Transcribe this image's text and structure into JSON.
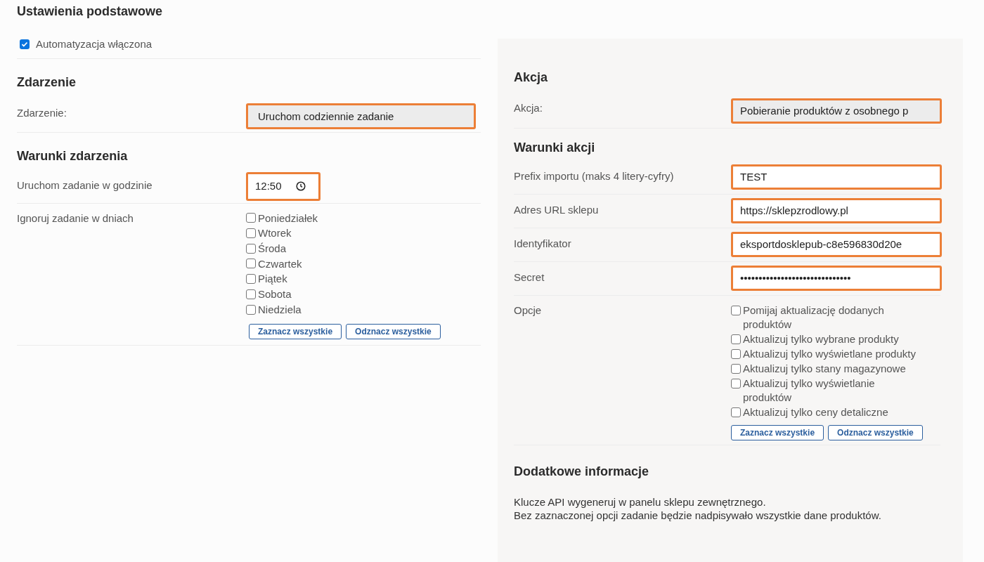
{
  "basic": {
    "title": "Ustawienia podstawowe",
    "automation": {
      "label": "Automatyzacja włączona",
      "checked": true
    }
  },
  "event": {
    "title": "Zdarzenie",
    "label": "Zdarzenie:",
    "value": "Uruchom codziennie zadanie"
  },
  "event_conditions": {
    "title": "Warunki zdarzenia",
    "time_label": "Uruchom zadanie w godzinie",
    "time_value": "12:50",
    "days_label": "Ignoruj zadanie w dniach",
    "days": [
      {
        "label": "Poniedziałek",
        "checked": false
      },
      {
        "label": "Wtorek",
        "checked": false
      },
      {
        "label": "Środa",
        "checked": false
      },
      {
        "label": "Czwartek",
        "checked": false
      },
      {
        "label": "Piątek",
        "checked": false
      },
      {
        "label": "Sobota",
        "checked": false
      },
      {
        "label": "Niedziela",
        "checked": false
      }
    ],
    "buttons": [
      "Zaznacz wszystkie",
      "Odznacz wszystkie"
    ]
  },
  "action": {
    "title": "Akcja",
    "label": "Akcja:",
    "value": "Pobieranie produktów z osobnego p"
  },
  "action_conditions": {
    "title": "Warunki akcji",
    "fields": [
      {
        "label": "Prefix importu (maks 4 litery-cyfry)",
        "value": "TEST"
      },
      {
        "label": "Adres URL sklepu",
        "value": "https://sklepzrodlowy.pl"
      },
      {
        "label": "Identyfikator",
        "value": "eksportdosklepub-c8e596830d20e"
      },
      {
        "label": "Secret",
        "value": "••••••••••••••••••••••••••••••"
      }
    ],
    "options_label": "Opcje",
    "options": [
      {
        "label": "Pomijaj aktualizację dodanych produktów",
        "checked": false
      },
      {
        "label": "Aktualizuj tylko wybrane produkty",
        "checked": false
      },
      {
        "label": "Aktualizuj tylko wyświetlane produkty",
        "checked": false
      },
      {
        "label": "Aktualizuj tylko stany magazynowe",
        "checked": false
      },
      {
        "label": "Aktualizuj tylko wyświetlanie produktów",
        "checked": false
      },
      {
        "label": "Aktualizuj tylko ceny detaliczne",
        "checked": false
      }
    ],
    "buttons": [
      "Zaznacz wszystkie",
      "Odznacz wszystkie"
    ]
  },
  "additional": {
    "title": "Dodatkowe informacje",
    "lines": [
      "Klucze API wygeneruj w panelu sklepu zewnętrznego.",
      "Bez zaznaczonej opcji zadanie będzie nadpisywało wszystkie dane produktów."
    ]
  }
}
